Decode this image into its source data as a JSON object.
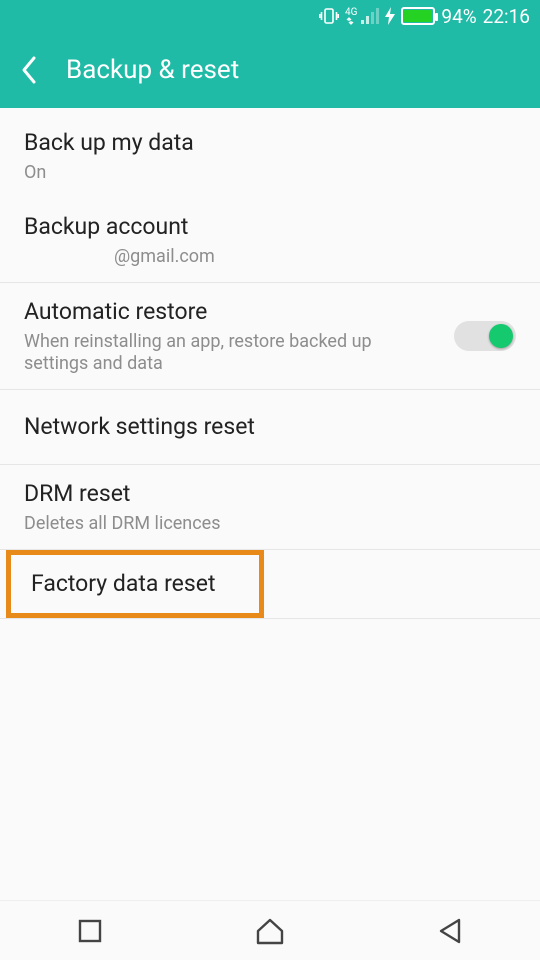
{
  "status": {
    "network_label_top": "4G",
    "battery_pct": "94%",
    "time": "22:16"
  },
  "appbar": {
    "title": "Backup & reset"
  },
  "rows": {
    "backup_data": {
      "title": "Back up my data",
      "sub": "On"
    },
    "backup_account": {
      "title": "Backup account",
      "sub": "@gmail.com"
    },
    "auto_restore": {
      "title": "Automatic restore",
      "sub": "When reinstalling an app, restore backed up settings and data"
    },
    "network_reset": {
      "title": "Network settings reset"
    },
    "drm_reset": {
      "title": "DRM reset",
      "sub": "Deletes all DRM licences"
    },
    "factory_reset": {
      "title": "Factory data reset"
    }
  }
}
